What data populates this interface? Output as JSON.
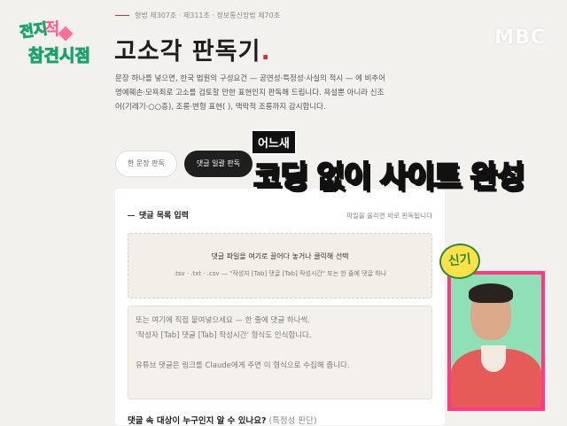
{
  "overlay": {
    "show_logo": {
      "line1": "전지",
      "line2": "적",
      "line3": "참견시점"
    },
    "channel_logo": "MBC",
    "caption_small": "어느새",
    "caption_big_white": "코딩 없이 ",
    "caption_big_yellow": "사이트 완성",
    "reaction_caption": "신기"
  },
  "page": {
    "law_refs": "형법 제307조 · 제311조 · 정보통신망법 제70조",
    "title": "고소각 판독기",
    "title_dot": ".",
    "description": [
      "문장 하나를 넣으면, 한국 법원의 구성요건 — 공연성·특정성·사실의 적시 — 에 비추어",
      "명예훼손·모욕죄로 고소를 검토할 만한 표현인지 판독해 드립니다. 욕설뿐 아니라 신조",
      "어(기레기·○○충), 조롱·변형 표현(          ), 맥락적 조롱까지 감시합니다."
    ],
    "mode_tabs": [
      {
        "label": "한 문장 판독",
        "active": false
      },
      {
        "label": "댓글 일괄 판독",
        "active": true
      }
    ],
    "card": {
      "heading": "댓글 목록 입력",
      "hint": "파일을 올리면 바로 판독됩니다",
      "drop_title": "댓글 파일을 여기로 끌어다 놓거나 클릭해 선택",
      "drop_sub": ".tsv · .txt · .csv — \"작성자 [Tab] 댓글 [Tab] 작성시간\" 또는 한 줄에 댓글 하나",
      "textarea_lines": [
        "또는 여기에 직접 붙여넣으세요 — 한 줄에 댓글 하나씩.",
        "'작성자 [Tab] 댓글 [Tab] 작성시간' 형식도 인식합니다.",
        "",
        "유튜브 댓글은 링크를 Claude에게 주면 이 형식으로 수집해 줍니다."
      ],
      "question": "댓글 속 대상이 누구인지 알 수 있나요?",
      "question_optional": " (특정성 판단)"
    }
  },
  "colors": {
    "accent_red": "#d23333",
    "active_pill": "#1f1f1f",
    "caption_yellow": "#ffd21a",
    "frame_pink": "#ff3a82"
  }
}
